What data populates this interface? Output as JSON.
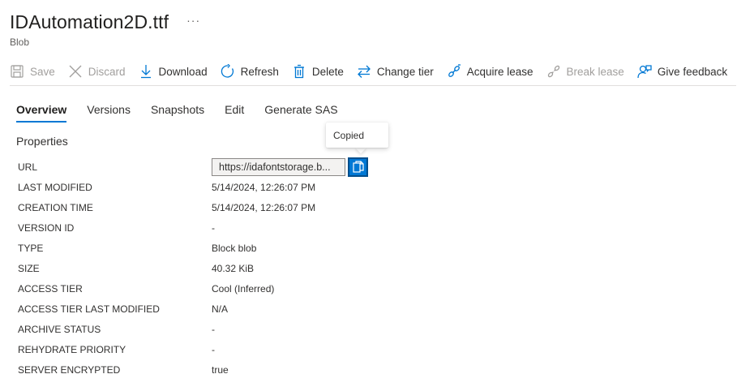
{
  "header": {
    "title": "IDAutomation2D.ttf",
    "more": "···",
    "subtitle": "Blob"
  },
  "toolbar": {
    "save": "Save",
    "discard": "Discard",
    "download": "Download",
    "refresh": "Refresh",
    "delete": "Delete",
    "change_tier": "Change tier",
    "acquire_lease": "Acquire lease",
    "break_lease": "Break lease",
    "give_feedback": "Give feedback"
  },
  "tabs": [
    {
      "label": "Overview",
      "active": true
    },
    {
      "label": "Versions"
    },
    {
      "label": "Snapshots"
    },
    {
      "label": "Edit"
    },
    {
      "label": "Generate SAS"
    }
  ],
  "section_title": "Properties",
  "tooltip": "Copied",
  "url": {
    "label": "URL",
    "value": "https://idafontstorage.b..."
  },
  "properties": [
    {
      "key": "LAST MODIFIED",
      "value": "5/14/2024, 12:26:07 PM"
    },
    {
      "key": "CREATION TIME",
      "value": "5/14/2024, 12:26:07 PM"
    },
    {
      "key": "VERSION ID",
      "value": "-"
    },
    {
      "key": "TYPE",
      "value": "Block blob"
    },
    {
      "key": "SIZE",
      "value": "40.32 KiB"
    },
    {
      "key": "ACCESS TIER",
      "value": "Cool (Inferred)"
    },
    {
      "key": "ACCESS TIER LAST MODIFIED",
      "value": "N/A"
    },
    {
      "key": "ARCHIVE STATUS",
      "value": "-"
    },
    {
      "key": "REHYDRATE PRIORITY",
      "value": "-"
    },
    {
      "key": "SERVER ENCRYPTED",
      "value": "true"
    }
  ],
  "colors": {
    "accent": "#0078d4",
    "disabled": "#a19f9d",
    "text": "#323130"
  }
}
